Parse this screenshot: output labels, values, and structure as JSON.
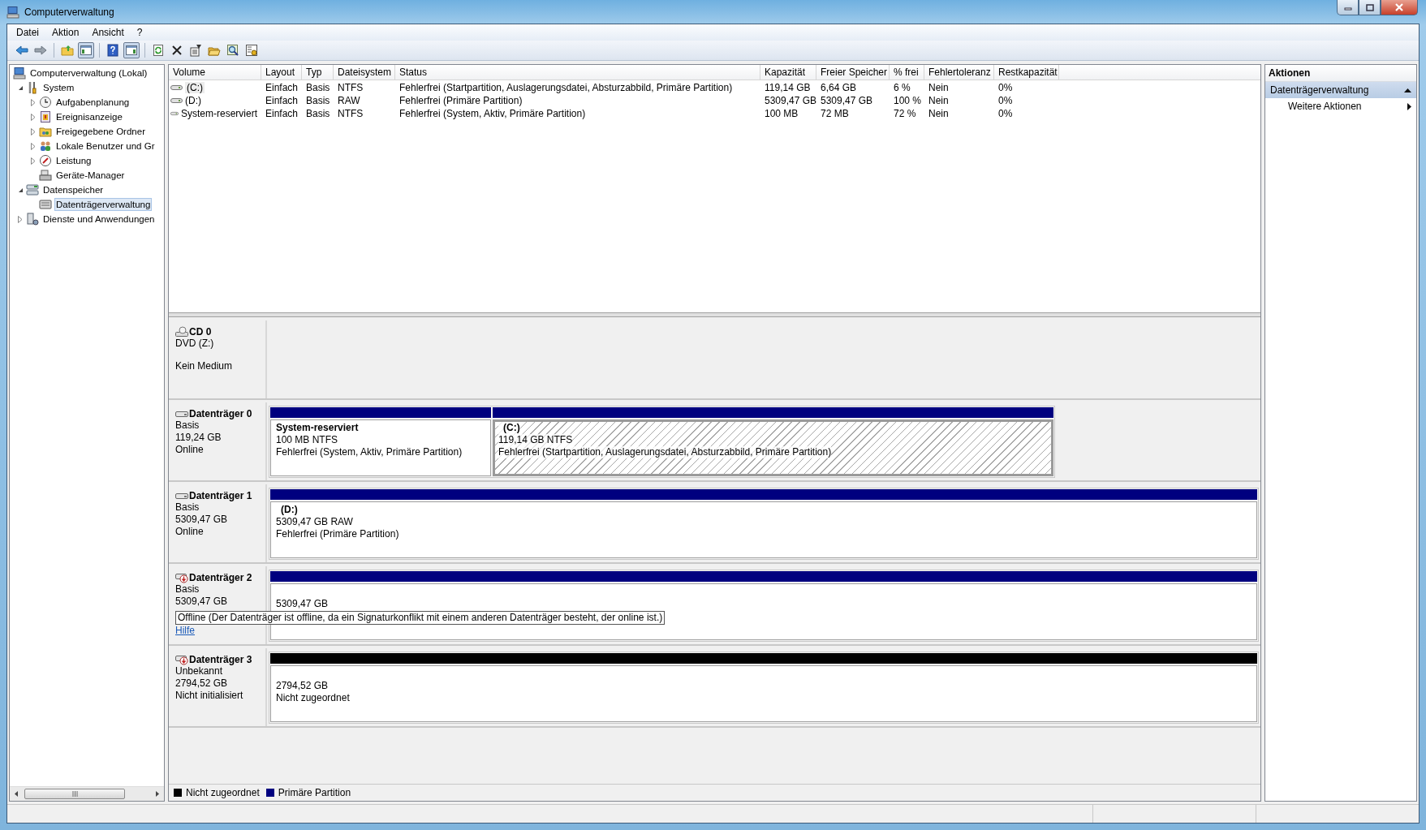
{
  "window": {
    "title": "Computerverwaltung"
  },
  "menu": [
    {
      "label": "Datei"
    },
    {
      "label": "Aktion"
    },
    {
      "label": "Ansicht"
    },
    {
      "label": "?"
    }
  ],
  "toolbar": [
    [
      {
        "kind": "back",
        "pressed": false
      },
      {
        "kind": "forward",
        "pressed": false
      }
    ],
    [
      {
        "kind": "up",
        "pressed": false
      },
      {
        "kind": "tree",
        "pressed": true
      }
    ],
    [
      {
        "kind": "help",
        "pressed": false
      },
      {
        "kind": "actions",
        "pressed": true
      }
    ],
    [
      {
        "kind": "refresh",
        "pressed": false
      },
      {
        "kind": "delete",
        "pressed": false
      },
      {
        "kind": "properties",
        "pressed": false
      },
      {
        "kind": "open",
        "pressed": false
      },
      {
        "kind": "search",
        "pressed": false
      },
      {
        "kind": "settings",
        "pressed": false
      }
    ]
  ],
  "tree": [
    {
      "label": "Computerverwaltung (Lokal)",
      "kind": "computer",
      "selected": false,
      "children": [
        {
          "label": "System",
          "kind": "tools",
          "expanded": true,
          "selected": false,
          "children": [
            {
              "label": "Aufgabenplanung",
              "kind": "clock",
              "expanded": false,
              "selected": false
            },
            {
              "label": "Ereignisanzeige",
              "kind": "log",
              "expanded": false,
              "selected": false
            },
            {
              "label": "Freigegebene Ordner",
              "kind": "shared",
              "expanded": false,
              "selected": false
            },
            {
              "label": "Lokale Benutzer und Gr",
              "kind": "users",
              "expanded": false,
              "selected": false
            },
            {
              "label": "Leistung",
              "kind": "gauge",
              "expanded": false,
              "selected": false
            },
            {
              "label": "Geräte-Manager",
              "kind": "device",
              "selected": false
            }
          ]
        },
        {
          "label": "Datenspeicher",
          "kind": "storage",
          "expanded": true,
          "selected": false,
          "children": [
            {
              "label": "Datenträgerverwaltung",
              "kind": "diskmgmt",
              "selected": true
            }
          ]
        },
        {
          "label": "Dienste und Anwendungen",
          "kind": "services",
          "expanded": false,
          "selected": false
        }
      ]
    }
  ],
  "table": {
    "columns": [
      "Volume",
      "Layout",
      "Typ",
      "Dateisystem",
      "Status",
      "Kapazität",
      "Freier Speicher",
      "% frei",
      "Fehlertoleranz",
      "Restkapazität"
    ],
    "rows": [
      {
        "selected": true,
        "cells": [
          "(C:)",
          "Einfach",
          "Basis",
          "NTFS",
          "Fehlerfrei (Startpartition, Auslagerungsdatei, Absturzabbild, Primäre Partition)",
          "119,14 GB",
          "6,64 GB",
          "6 %",
          "Nein",
          "0%"
        ]
      },
      {
        "selected": false,
        "cells": [
          "(D:)",
          "Einfach",
          "Basis",
          "RAW",
          "Fehlerfrei (Primäre Partition)",
          "5309,47 GB",
          "5309,47 GB",
          "100 %",
          "Nein",
          "0%"
        ]
      },
      {
        "selected": false,
        "cells": [
          "System-reserviert",
          "Einfach",
          "Basis",
          "NTFS",
          "Fehlerfrei (System, Aktiv, Primäre Partition)",
          "100 MB",
          "72 MB",
          "72 %",
          "Nein",
          "0%"
        ]
      }
    ]
  },
  "disks": [
    {
      "kind": "cd",
      "name": "CD 0",
      "type": "DVD (Z:)",
      "status": "Kein Medium"
    },
    {
      "kind": "disk",
      "name": "Datenträger 0",
      "type": "Basis",
      "size": "119,24 GB",
      "status": "Online",
      "partitions": [
        {
          "kind": "primary",
          "selected": false,
          "label": "System-reserviert",
          "size": "100 MB NTFS",
          "status": "Fehlerfrei (System, Aktiv, Primäre Partition)"
        },
        {
          "kind": "primary",
          "selected": true,
          "label": "(C:)",
          "size": "119,14 GB NTFS",
          "status": "Fehlerfrei (Startpartition, Auslagerungsdatei, Absturzabbild, Primäre Partition)"
        }
      ]
    },
    {
      "kind": "disk",
      "name": "Datenträger 1",
      "type": "Basis",
      "size": "5309,47 GB",
      "status": "Online",
      "partitions": [
        {
          "kind": "primary",
          "selected": false,
          "label": "(D:)",
          "size": "5309,47 GB RAW",
          "status": "Fehlerfrei (Primäre Partition)"
        }
      ]
    },
    {
      "kind": "disk_error",
      "name": "Datenträger 2",
      "type": "Basis",
      "size": "5309,47 GB",
      "message": "Offline (Der Datenträger ist offline, da ein Signaturkonflikt mit einem anderen Datenträger besteht, der online ist.)",
      "help": "Hilfe",
      "partitions": [
        {
          "kind": "primary",
          "selected": false,
          "size": "5309,47 GB"
        }
      ]
    },
    {
      "kind": "disk_error",
      "name": "Datenträger 3",
      "type": "Unbekannt",
      "size": "2794,52 GB",
      "status": "Nicht initialisiert",
      "partitions": [
        {
          "kind": "unallocated",
          "selected": false,
          "size": "2794,52 GB",
          "status": "Nicht zugeordnet"
        }
      ]
    }
  ],
  "legend": [
    {
      "label": "Nicht zugeordnet",
      "color": "#000000"
    },
    {
      "label": "Primäre Partition",
      "color": "#00007f"
    }
  ],
  "actions": {
    "title": "Aktionen",
    "section": {
      "label": "Datenträgerverwaltung",
      "expanded": true
    },
    "items": [
      {
        "label": "Weitere Aktionen"
      }
    ]
  }
}
